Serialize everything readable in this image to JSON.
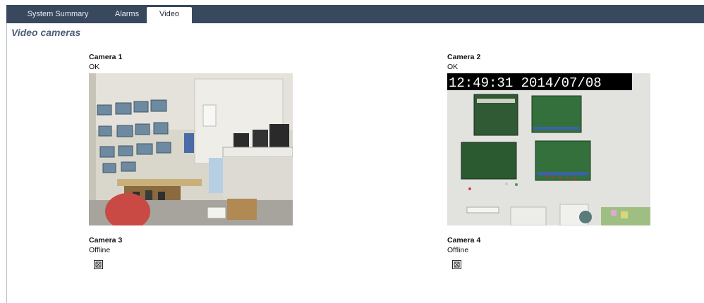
{
  "tabs": [
    {
      "label": "System Summary"
    },
    {
      "label": "Alarms"
    },
    {
      "label": "Video",
      "active": true
    }
  ],
  "page_title": "Video cameras",
  "cameras": [
    {
      "name": "Camera 1",
      "status": "OK"
    },
    {
      "name": "Camera 2",
      "status": "OK",
      "overlay": "12:49:31  2014/07/08"
    },
    {
      "name": "Camera 3",
      "status": "Offline"
    },
    {
      "name": "Camera 4",
      "status": "Offline"
    }
  ],
  "colors": {
    "tabbar": "#38495e",
    "title": "#4d5f78"
  }
}
